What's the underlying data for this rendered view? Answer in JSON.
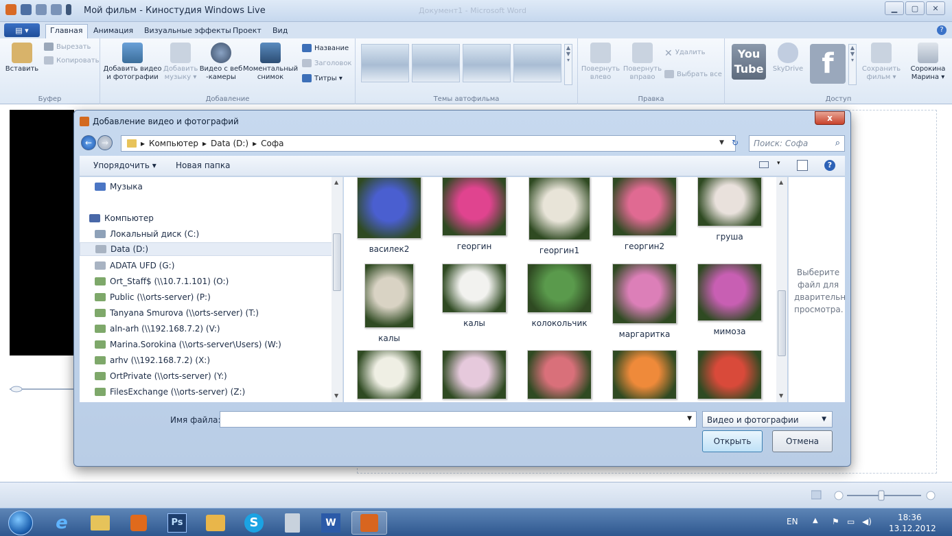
{
  "window": {
    "title": "Мой фильм - Киностудия Windows Live",
    "background_title": "Документ1 - Microsoft Word"
  },
  "ribbon": {
    "app_menu_label": "▤ ▾",
    "tabs": [
      "Главная",
      "Анимация",
      "Визуальные эффекты",
      "Проект",
      "Вид"
    ],
    "clipboard": {
      "paste": "Вставить",
      "cut": "Вырезать",
      "copy": "Копировать",
      "group": "Буфер"
    },
    "add": {
      "add_video_photo": "Добавить видео и фотографии",
      "add_music": "Добавить музыку ▾",
      "webcam": "Видео с веб -камеры",
      "snapshot": "Моментальный снимок",
      "title": "Название",
      "caption": "Заголовок",
      "credits": "Титры ▾",
      "group": "Добавление"
    },
    "themes_group": "Темы автофильма",
    "edit": {
      "rotate_left": "Повернуть влево",
      "rotate_right": "Повернуть вправо",
      "delete": "Удалить",
      "select_all": "Выбрать все",
      "group": "Правка"
    },
    "share": {
      "youtube": "You Tube",
      "skydrive": "SkyDrive",
      "save_movie": "Сохранить фильм ▾",
      "user": "Сорокина Марина ▾",
      "group": "Доступ"
    }
  },
  "dialog": {
    "title": "Добавление видео и фотографий",
    "close": "x",
    "breadcrumb": [
      "Компьютер",
      "Data (D:)",
      "Софа"
    ],
    "search_placeholder": "Поиск: Софа",
    "toolbar": {
      "organize": "Упорядочить ▾",
      "new_folder": "Новая папка"
    },
    "nav_items": [
      "Музыка",
      "Компьютер",
      "Локальный диск (C:)",
      "Data (D:)",
      "ADATA UFD (G:)",
      "Ort_Staff$ (\\\\10.7.1.101) (O:)",
      "Public (\\\\orts-server) (P:)",
      "Tanyana Smurova (\\\\orts-server) (T:)",
      "aln-arh (\\\\192.168.7.2) (V:)",
      "Marina.Sorokina (\\\\orts-server\\Users) (W:)",
      "arhv (\\\\192.168.7.2) (X:)",
      "OrtPrivate (\\\\orts-server) (Y:)",
      "FilesExchange (\\\\orts-server) (Z:)"
    ],
    "files": [
      {
        "name": "василек2",
        "color": "#4a5fd0"
      },
      {
        "name": "георгин",
        "color": "#e0448f"
      },
      {
        "name": "георгин1",
        "color": "#e8e4d8"
      },
      {
        "name": "георгин2",
        "color": "#e06a92"
      },
      {
        "name": "груша",
        "color": "#e9e1dc"
      },
      {
        "name": "калы",
        "color": "#d9d3c4"
      },
      {
        "name": "калы",
        "color": "#f2f2ef"
      },
      {
        "name": "колокольчик",
        "color": "#5a9a4c"
      },
      {
        "name": "маргаритка",
        "color": "#dc7fb8"
      },
      {
        "name": "мимоза",
        "color": "#c85fb3"
      },
      {
        "name": "",
        "color": "#efefe4"
      },
      {
        "name": "",
        "color": "#e6c9dc"
      },
      {
        "name": "",
        "color": "#d9707a"
      },
      {
        "name": "",
        "color": "#ef8a3a"
      },
      {
        "name": "",
        "color": "#d94a3a"
      }
    ],
    "preview_text": "Выберите файл для дварительн просмотра.",
    "filename_label": "Имя файла:",
    "filename_value": "",
    "filetype": "Видео и фотографии",
    "open": "Открыть",
    "cancel": "Отмена"
  },
  "taskbar": {
    "apps": [
      "e",
      "",
      "",
      "Ps",
      "",
      "S",
      "",
      "W",
      ""
    ],
    "lang": "EN",
    "time": "18:36",
    "date": "13.12.2012"
  }
}
